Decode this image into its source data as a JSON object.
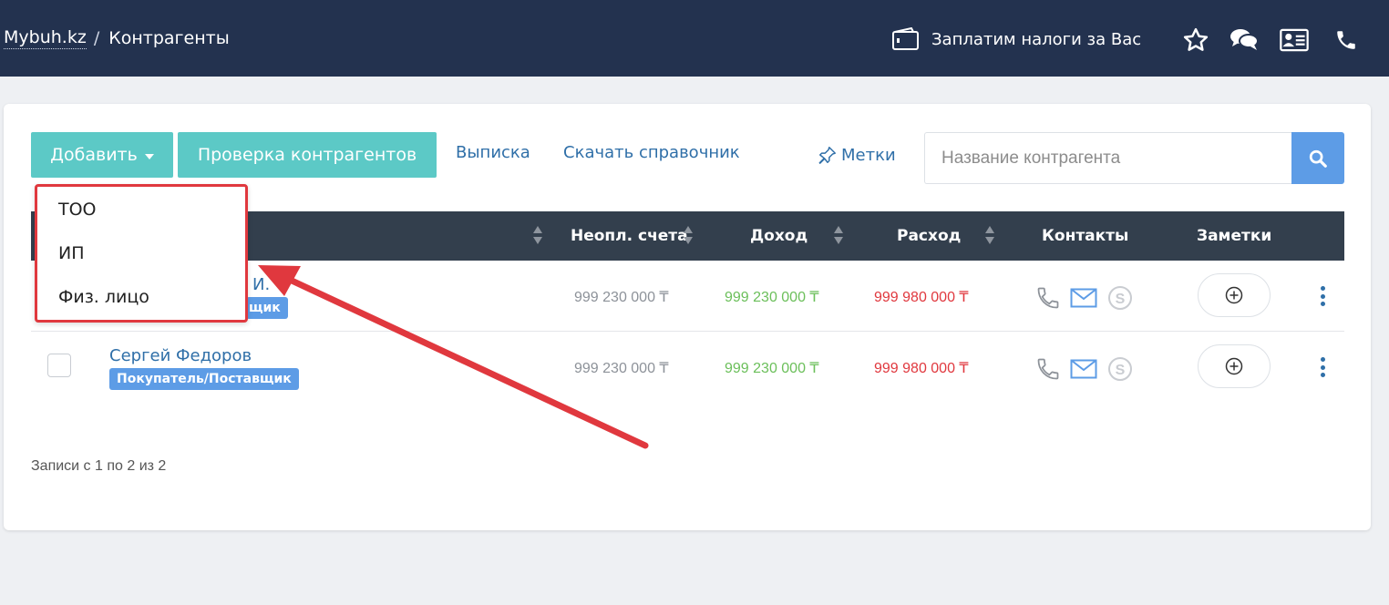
{
  "header": {
    "breadcrumb_home": "Mybuh.kz",
    "breadcrumb_sep": "/",
    "breadcrumb_current": "Контрагенты",
    "promo_text": "Заплатим налоги за Вас",
    "icons": [
      "wallet-icon",
      "star-icon",
      "chat-icon",
      "contact-card-icon",
      "phone-icon"
    ],
    "bg_color": "#23324f"
  },
  "toolbar": {
    "add_label": "Добавить",
    "check_label": "Проверка контрагентов",
    "statement_link": "Выписка",
    "download_link": "Скачать справочник",
    "tags_link": "Метки",
    "search_placeholder": "Название контрагента",
    "accent_teal": "#5cc9c6",
    "accent_blue": "#5d9ce6"
  },
  "dropdown": {
    "items": [
      "ТОО",
      "ИП",
      "Физ. лицо"
    ]
  },
  "table": {
    "columns": [
      "Неопл. счета",
      "Доход",
      "Расход",
      "Контакты",
      "Заметки"
    ],
    "rows": [
      {
        "name_visible": "И.",
        "badge_visible": "щик",
        "unpaid": "999 230 000 ₸",
        "income": "999 230 000 ₸",
        "expense": "999 980 000 ₸"
      },
      {
        "name": "Сергей Федоров",
        "badge": "Покупатель/Поставщик",
        "unpaid": "999 230 000 ₸",
        "income": "999 230 000 ₸",
        "expense": "999 980 000 ₸"
      }
    ]
  },
  "footer": {
    "records_text": "Записи с 1 по 2 из 2"
  }
}
